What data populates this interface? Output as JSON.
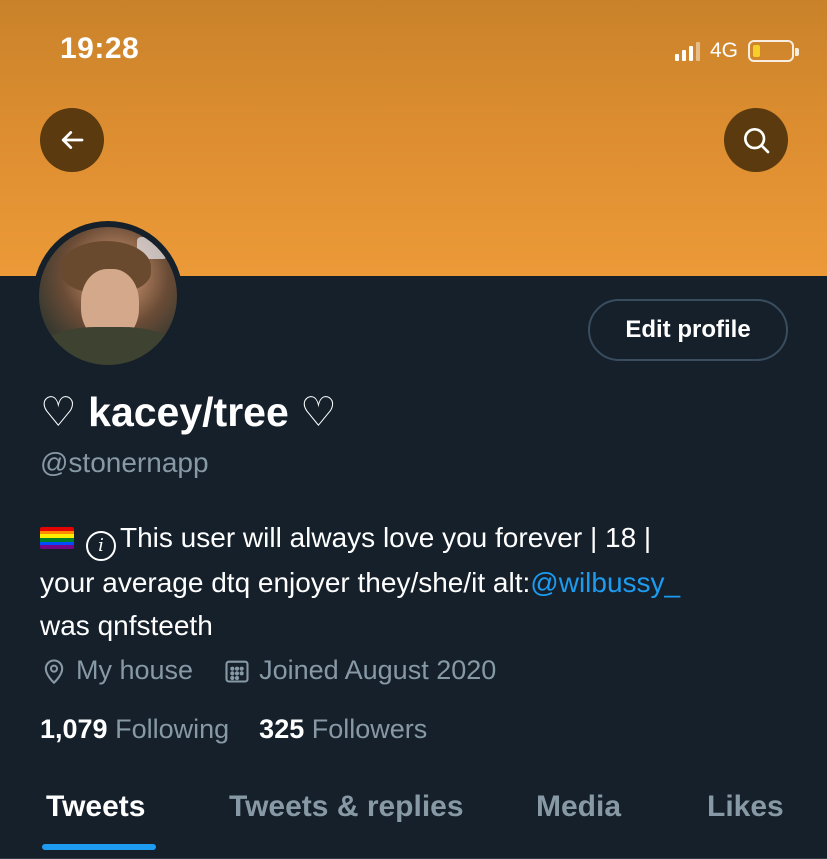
{
  "status_bar": {
    "time": "19:28",
    "network": "4G",
    "battery_color": "#f5d028"
  },
  "header": {
    "back_icon": "arrow-left-icon",
    "search_icon": "search-icon",
    "banner_color": "#ec9a38"
  },
  "profile": {
    "edit_label": "Edit profile",
    "display_name": "♡ kacey/tree ♡",
    "handle": "@stonernapp",
    "bio_line1": "This user will always love you forever | 18 |",
    "bio_line2_prefix": "your average dtq enjoyer they/she/it alt:",
    "bio_mention": "@wilbussy_",
    "bio_line3": "was qnfsteeth",
    "location": "My house",
    "joined": "Joined August 2020",
    "following_count": "1,079",
    "following_label": "Following",
    "followers_count": "325",
    "followers_label": "Followers"
  },
  "tabs": [
    {
      "label": "Tweets",
      "active": true
    },
    {
      "label": "Tweets & replies",
      "active": false
    },
    {
      "label": "Media",
      "active": false
    },
    {
      "label": "Likes",
      "active": false
    }
  ],
  "colors": {
    "background": "#15202b",
    "accent": "#1d9bf0",
    "muted_text": "#8899a6"
  }
}
